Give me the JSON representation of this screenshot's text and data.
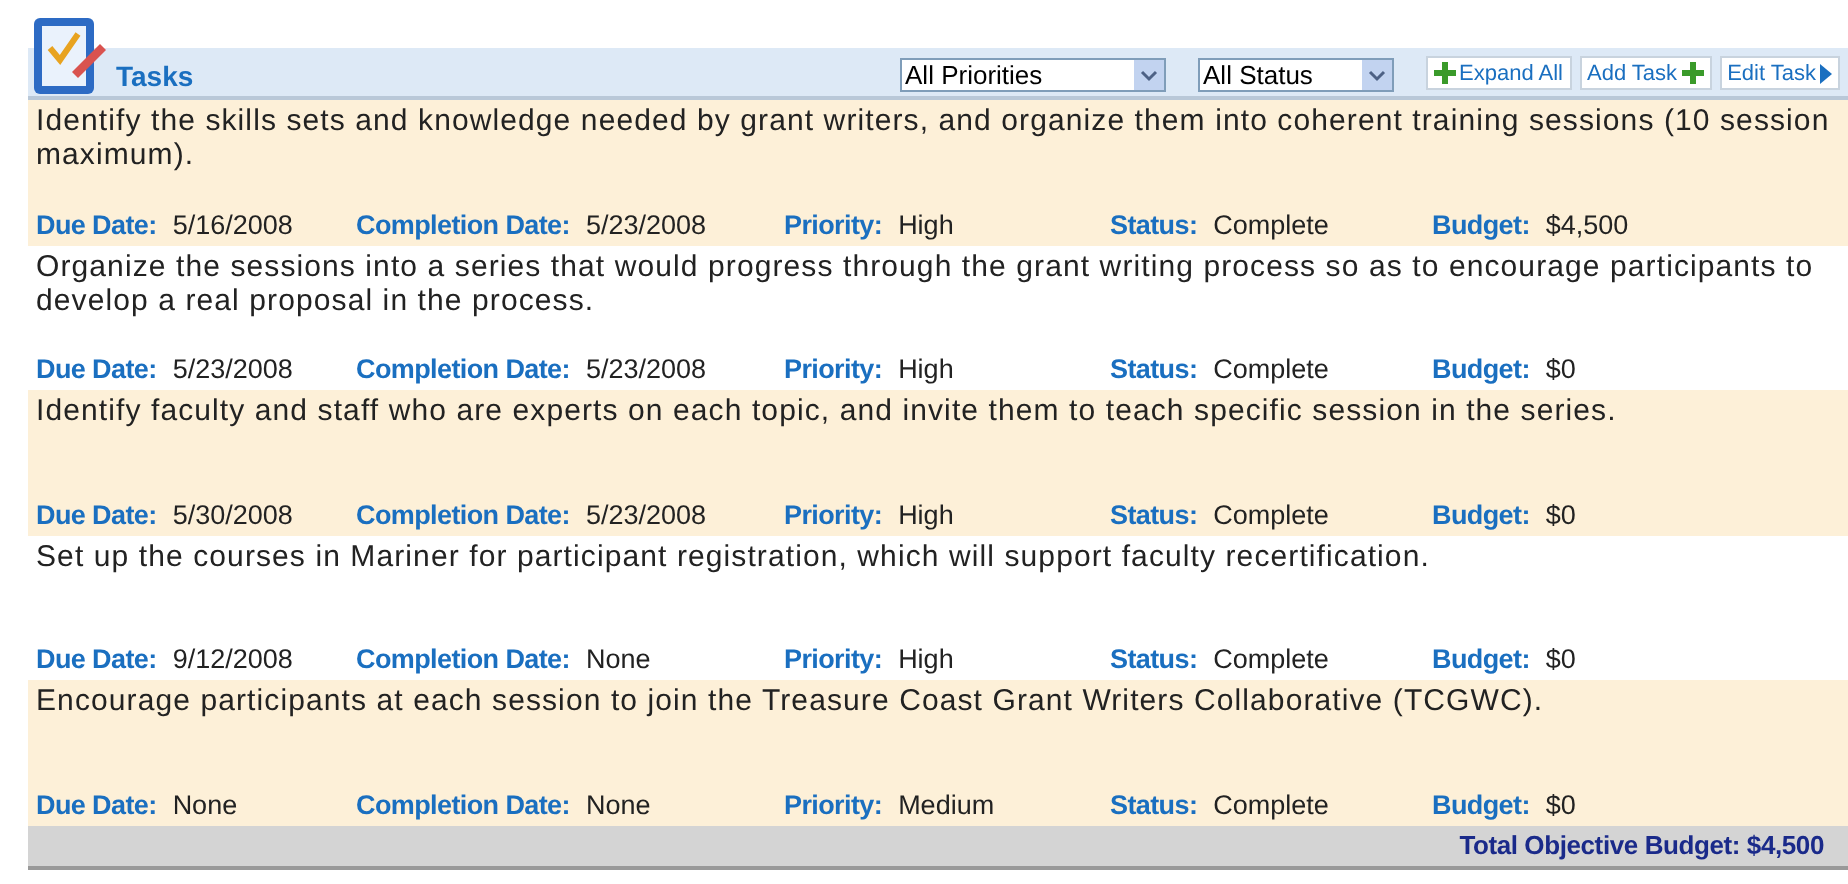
{
  "header": {
    "title": "Tasks",
    "filters": [
      {
        "value": "All Priorities"
      },
      {
        "value": "All Status"
      }
    ],
    "buttons": [
      {
        "label": "Expand All"
      },
      {
        "label": "Add Task"
      },
      {
        "label": "Edit Task"
      }
    ]
  },
  "tasks": [
    {
      "description": "Identify the skills sets and knowledge needed by grant writers, and organize them into coherent training sessions (10 session maximum).",
      "fields": [
        {
          "label": "Due Date:",
          "value": "5/16/2008"
        },
        {
          "label": "Completion Date:",
          "value": "5/23/2008"
        },
        {
          "label": "Priority:",
          "value": "High"
        },
        {
          "label": "Status:",
          "value": "Complete"
        },
        {
          "label": "Budget:",
          "value": "$4,500"
        }
      ]
    },
    {
      "description": "Organize the sessions into a series that would progress through the grant writing process so as to encourage participants to develop a real proposal in the process.",
      "fields": [
        {
          "label": "Due Date:",
          "value": "5/23/2008"
        },
        {
          "label": "Completion Date:",
          "value": "5/23/2008"
        },
        {
          "label": "Priority:",
          "value": "High"
        },
        {
          "label": "Status:",
          "value": "Complete"
        },
        {
          "label": "Budget:",
          "value": "$0"
        }
      ]
    },
    {
      "description": "Identify faculty and staff who are experts on each topic, and invite them to teach specific session in the series.",
      "fields": [
        {
          "label": "Due Date:",
          "value": "5/30/2008"
        },
        {
          "label": "Completion Date:",
          "value": "5/23/2008"
        },
        {
          "label": "Priority:",
          "value": "High"
        },
        {
          "label": "Status:",
          "value": "Complete"
        },
        {
          "label": "Budget:",
          "value": "$0"
        }
      ]
    },
    {
      "description": "Set up the courses in Mariner for participant registration, which will support faculty recertification.",
      "fields": [
        {
          "label": "Due Date:",
          "value": "9/12/2008"
        },
        {
          "label": "Completion Date:",
          "value": "None"
        },
        {
          "label": "Priority:",
          "value": "High"
        },
        {
          "label": "Status:",
          "value": "Complete"
        },
        {
          "label": "Budget:",
          "value": "$0"
        }
      ]
    },
    {
      "description": "Encourage participants at each session to join the Treasure Coast Grant Writers Collaborative (TCGWC).",
      "fields": [
        {
          "label": "Due Date:",
          "value": "None"
        },
        {
          "label": "Completion Date:",
          "value": "None"
        },
        {
          "label": "Priority:",
          "value": "Medium"
        },
        {
          "label": "Status:",
          "value": "Complete"
        },
        {
          "label": "Budget:",
          "value": "$0"
        }
      ]
    }
  ],
  "total": "Total Objective Budget: $4,500"
}
